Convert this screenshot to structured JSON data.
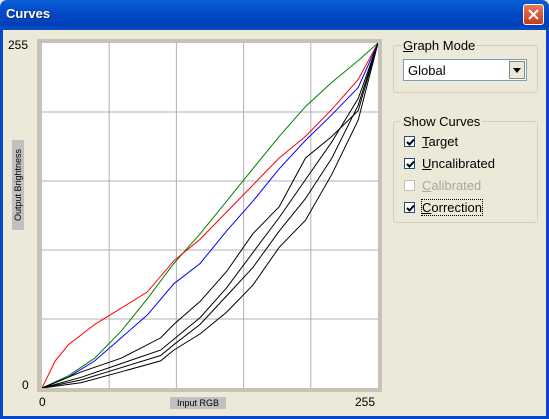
{
  "window": {
    "title": "Curves",
    "title_color": "#0349c9"
  },
  "graph": {
    "y_top_label": "255",
    "y_bottom_label": "0",
    "x_left_label": "0",
    "x_right_label": "255",
    "y_axis_title": "Output Brightness",
    "x_axis_title": "Input RGB",
    "grid_divisions": 5
  },
  "chart_data": {
    "type": "line",
    "xlim": [
      0,
      255
    ],
    "ylim": [
      0,
      255
    ],
    "grid": true,
    "series": [
      {
        "color": "#008000",
        "x": [
          0,
          20,
          40,
          60,
          80,
          100,
          120,
          140,
          160,
          180,
          200,
          220,
          240,
          255
        ],
        "y": [
          0,
          9,
          22,
          42,
          66,
          92,
          114,
          138,
          162,
          186,
          208,
          226,
          242,
          255
        ]
      },
      {
        "color": "#ff0000",
        "x": [
          0,
          10,
          20,
          40,
          60,
          80,
          100,
          120,
          140,
          160,
          180,
          200,
          220,
          240,
          255
        ],
        "y": [
          0,
          20,
          32,
          47,
          59,
          71,
          94,
          110,
          130,
          150,
          170,
          186,
          206,
          228,
          255
        ]
      },
      {
        "color": "#0000ff",
        "x": [
          0,
          20,
          40,
          60,
          80,
          100,
          120,
          140,
          160,
          180,
          200,
          220,
          240,
          255
        ],
        "y": [
          0,
          8,
          20,
          37,
          54,
          77,
          92,
          116,
          138,
          162,
          183,
          202,
          222,
          255
        ]
      },
      {
        "color": "#000000",
        "x": [
          0,
          30,
          60,
          90,
          100,
          120,
          140,
          160,
          180,
          200,
          220,
          240,
          255
        ],
        "y": [
          0,
          12,
          22,
          37,
          47,
          64,
          86,
          114,
          134,
          170,
          186,
          205,
          255
        ]
      },
      {
        "color": "#000000",
        "x": [
          0,
          30,
          60,
          90,
          100,
          120,
          140,
          160,
          180,
          200,
          220,
          240,
          255
        ],
        "y": [
          0,
          6,
          15,
          24,
          32,
          47,
          68,
          89,
          116,
          140,
          170,
          209,
          255
        ]
      },
      {
        "color": "#000000",
        "x": [
          0,
          30,
          60,
          90,
          100,
          120,
          140,
          160,
          180,
          200,
          220,
          240,
          255
        ],
        "y": [
          0,
          8,
          18,
          28,
          36,
          52,
          74,
          100,
          126,
          154,
          182,
          214,
          255
        ]
      },
      {
        "color": "#000000",
        "x": [
          0,
          30,
          60,
          90,
          100,
          120,
          140,
          160,
          180,
          200,
          220,
          240,
          255
        ],
        "y": [
          0,
          4,
          12,
          20,
          28,
          40,
          56,
          76,
          104,
          124,
          158,
          198,
          255
        ]
      }
    ]
  },
  "graph_mode": {
    "label_accel": "G",
    "label_rest": "raph Mode",
    "selected": "Global"
  },
  "show_curves": {
    "title": "Show Curves",
    "items": [
      {
        "accel": "T",
        "rest": "arget",
        "checked": true,
        "enabled": true
      },
      {
        "accel": "U",
        "rest": "ncalibrated",
        "checked": true,
        "enabled": true
      },
      {
        "accel": "C",
        "rest": "alibrated",
        "checked": false,
        "enabled": false
      },
      {
        "accel": "C",
        "rest": "orrection",
        "checked": true,
        "enabled": true
      }
    ]
  }
}
